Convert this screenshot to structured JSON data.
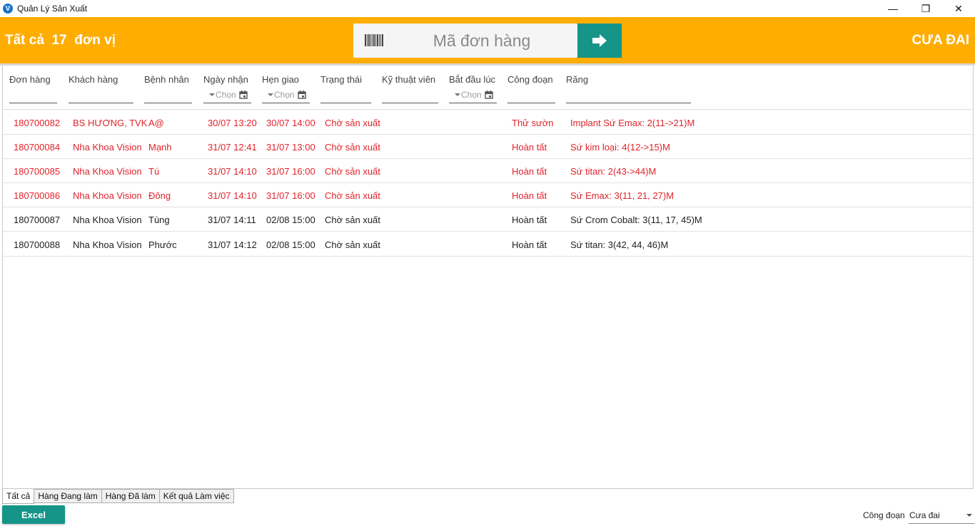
{
  "window": {
    "title": "Quản Lý Sản Xuất",
    "app_icon_letter": "V",
    "minimize": "—",
    "restore": "❐",
    "close": "✕"
  },
  "header": {
    "summary_prefix": "Tất cả",
    "unit_count": "17",
    "summary_suffix": "đơn vị",
    "search_placeholder": "Mã đơn hàng",
    "stage_name": "CƯA ĐAI",
    "brand_color": "#FFAD00",
    "accent_color": "#159488"
  },
  "grid": {
    "columns": [
      {
        "key": "order",
        "label": "Đơn hàng"
      },
      {
        "key": "customer",
        "label": "Khách hàng"
      },
      {
        "key": "patient",
        "label": "Bệnh nhân"
      },
      {
        "key": "received",
        "label": "Ngày nhận"
      },
      {
        "key": "due",
        "label": "Hẹn giao"
      },
      {
        "key": "status",
        "label": "Trạng thái"
      },
      {
        "key": "technician",
        "label": "Kỹ thuật viên"
      },
      {
        "key": "started",
        "label": "Bắt đầu lúc"
      },
      {
        "key": "stage",
        "label": "Công đoạn"
      },
      {
        "key": "teeth",
        "label": "Răng"
      }
    ],
    "date_filter_placeholder": "Chọn",
    "rows": [
      {
        "order": "180700082",
        "customer": "BS HƯƠNG, TVK",
        "patient": "A@",
        "received": "30/07 13:20",
        "due": "30/07 14:00",
        "status": "Chờ sản xuất",
        "technician": "",
        "started": "",
        "stage": "Thử sườn",
        "teeth": "Implant Sứ Emax: 2(11->21)M",
        "overdue": true
      },
      {
        "order": "180700084",
        "customer": "Nha Khoa Vision",
        "patient": "Mạnh",
        "received": "31/07 12:41",
        "due": "31/07 13:00",
        "status": "Chờ sản xuất",
        "technician": "",
        "started": "",
        "stage": "Hoàn tất",
        "teeth": "Sứ kim loại: 4(12->15)M",
        "overdue": true
      },
      {
        "order": "180700085",
        "customer": "Nha Khoa Vision",
        "patient": "Tú",
        "received": "31/07 14:10",
        "due": "31/07 16:00",
        "status": "Chờ sản xuất",
        "technician": "",
        "started": "",
        "stage": "Hoàn tất",
        "teeth": "Sứ titan: 2(43->44)M",
        "overdue": true
      },
      {
        "order": "180700086",
        "customer": "Nha Khoa Vision",
        "patient": "Đông",
        "received": "31/07 14:10",
        "due": "31/07 16:00",
        "status": "Chờ sản xuất",
        "technician": "",
        "started": "",
        "stage": "Hoàn tất",
        "teeth": "Sứ Emax: 3(11, 21, 27)M",
        "overdue": true
      },
      {
        "order": "180700087",
        "customer": "Nha Khoa Vision",
        "patient": "Tùng",
        "received": "31/07 14:11",
        "due": "02/08 15:00",
        "status": "Chờ sản xuất",
        "technician": "",
        "started": "",
        "stage": "Hoàn tất",
        "teeth": "Sứ Crom Cobalt: 3(11, 17, 45)M",
        "overdue": false
      },
      {
        "order": "180700088",
        "customer": "Nha Khoa Vision",
        "patient": "Phước",
        "received": "31/07 14:12",
        "due": "02/08 15:00",
        "status": "Chờ sản xuất",
        "technician": "",
        "started": "",
        "stage": "Hoàn tất",
        "teeth": "Sứ titan: 3(42, 44, 46)M",
        "overdue": false
      }
    ],
    "overdue_color": "#e0232a"
  },
  "tabs": [
    {
      "label": "Tất cả",
      "active": true
    },
    {
      "label": "Hàng Đang làm",
      "active": false
    },
    {
      "label": "Hàng Đã làm",
      "active": false
    },
    {
      "label": "Kết quả Làm việc",
      "active": false
    }
  ],
  "footer": {
    "excel_label": "Excel",
    "stage_label": "Công đoạn",
    "stage_value": "Cưa đai"
  }
}
